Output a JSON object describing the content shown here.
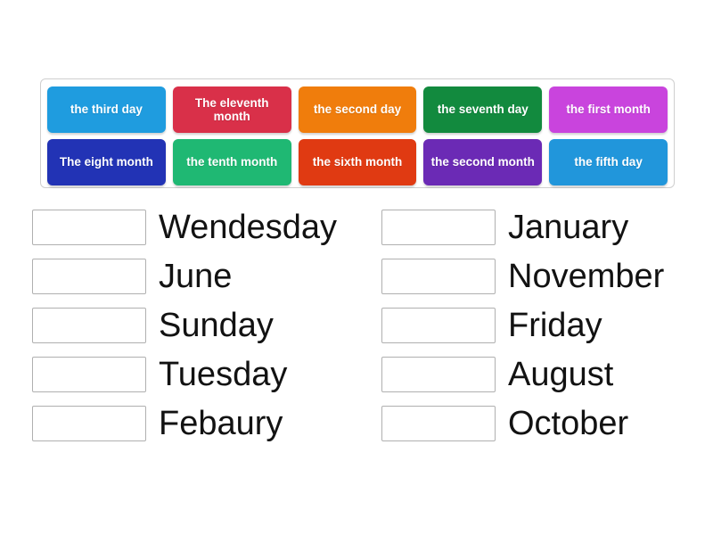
{
  "activity": {
    "type": "match-up",
    "tile_bank": {
      "rows": [
        [
          {
            "label": "the third day",
            "color": "#1f9cdf"
          },
          {
            "label": "The eleventh month",
            "color": "#d93049"
          },
          {
            "label": "the second day",
            "color": "#f07d0c"
          },
          {
            "label": "the seventh day",
            "color": "#128a3e"
          },
          {
            "label": "the first month",
            "color": "#c944dd"
          }
        ],
        [
          {
            "label": "The eight month",
            "color": "#2233b5"
          },
          {
            "label": "the tenth month",
            "color": "#1fb873"
          },
          {
            "label": "the sixth month",
            "color": "#e03a12"
          },
          {
            "label": "the second month",
            "color": "#6b2ab5"
          },
          {
            "label": "the fifth day",
            "color": "#2196db"
          }
        ]
      ]
    },
    "answers": {
      "left_column": [
        {
          "label": "Wendesday",
          "drop_value": ""
        },
        {
          "label": "June",
          "drop_value": ""
        },
        {
          "label": "Sunday",
          "drop_value": ""
        },
        {
          "label": "Tuesday",
          "drop_value": ""
        },
        {
          "label": "Febaury",
          "drop_value": ""
        }
      ],
      "right_column": [
        {
          "label": "January",
          "drop_value": ""
        },
        {
          "label": "November",
          "drop_value": ""
        },
        {
          "label": "Friday",
          "drop_value": ""
        },
        {
          "label": "August",
          "drop_value": ""
        },
        {
          "label": "October",
          "drop_value": ""
        }
      ]
    }
  }
}
